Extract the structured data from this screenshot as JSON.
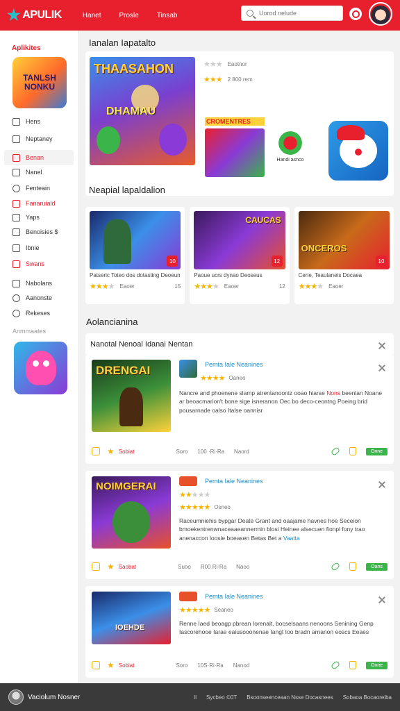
{
  "header": {
    "logo": "APULIK",
    "nav": [
      "Hanet",
      "Prosle",
      "Tinsab"
    ],
    "search_placeholder": "Uorod nelude"
  },
  "sidebar": {
    "title": "Aplikites",
    "art_text": "TANLSH NONKU",
    "items": [
      {
        "label": "Hens"
      },
      {
        "label": "Neptaney"
      },
      {
        "label": "Benan"
      },
      {
        "label": "Nanel"
      },
      {
        "label": "Fenteain"
      },
      {
        "label": "Fanaruiald"
      },
      {
        "label": "Yaps"
      },
      {
        "label": "Benoisies $"
      },
      {
        "label": "Ibnie"
      },
      {
        "label": "Swans"
      },
      {
        "label": "Nabolans"
      },
      {
        "label": "Aanonste"
      },
      {
        "label": "Rekeses"
      }
    ],
    "section_label": "Anmmaates"
  },
  "main": {
    "featured_title": "Ianalan Iapatalto",
    "hero": {
      "art_title": "THAASAHON",
      "art_sub": "DHAMAU",
      "meta1": "Eaotnor",
      "meta2": "2 800 rem",
      "mini1_text": "CROMENTRES",
      "mini2_text": "Handi asnco"
    },
    "popular_title": "Neapial lapaldalion",
    "cards": [
      {
        "caption": "Patseric Toteo dos dotasting Deoeun",
        "meta": "Eaoer",
        "num": "15",
        "badge": "10"
      },
      {
        "caption": "Paoue ucrs dynao Deoseus",
        "meta": "Eaoer",
        "num": "12",
        "badge": "12",
        "art_title": "CAUCAS"
      },
      {
        "caption": "Cerie, Teaulaneis Docaea",
        "meta": "Eaoer",
        "num": "",
        "badge": "10",
        "art_title": "ONCEROS"
      }
    ],
    "reviews_title": "Aolancianina",
    "reviews_head": "Nanotal Nenoal Idanai Nentan",
    "reviews": [
      {
        "art_title": "DRENGAI",
        "title": "Pemta Iale Neanines",
        "rating_text": "Oaneo",
        "body_pre": "Nancre and phoenene slamp atrentanooniz ooao hiarse ",
        "body_hl": "Nons",
        "body_post": " beenlan Noane ar beoacmarion't bone sige isneranon Oec bo deco-ceontng Poeing brid pousarnade oalso Italse oannisr",
        "foot_red": "Sobiat",
        "foot_mid": [
          "Soro",
          "100 ·Ri·Ra",
          "Naord"
        ],
        "btn": "Onne"
      },
      {
        "art_title": "NOIMGERAI",
        "title": "Pemta Iale Neanines",
        "rating_text": "Osneo",
        "body_pre": "Raceumniehis bypgar Deate Grant and oaajame havnes hoe Seceion bmoekentrenwnaceaaeannermin blosi Heinee alsecuen fionpl fony trao anenaccon loosie boeasen Betas Bet a ",
        "body_hl": "",
        "body_blue": "Vaatta",
        "body_post": "",
        "foot_red": "Saobat",
        "foot_mid": [
          "Suoo",
          "R00 Ri·Ra",
          "Naoo"
        ],
        "btn": "Oans"
      },
      {
        "art_title": "IOEHDE",
        "title": "Pemta Iale Neanines",
        "rating_text": "Seaneo",
        "body_pre": "Renne Iaed beoagp pbrean Iorenalt, bocselsaans nenoons Senining Genp Iascorehooe Iarae eaiusooonenae Iangt Ioo bradn arnanon eoscs Eeaes",
        "body_hl": "",
        "body_post": "",
        "foot_red": "Sobiat",
        "foot_mid": [
          "Soro",
          "10S·Ri·Ra",
          "Nanod"
        ],
        "btn": "Onrie"
      }
    ]
  },
  "footer": {
    "name": "Vaciolum Nosner",
    "links": [
      "Il",
      "Sycbeo ©0T",
      "Bsoonseenceaan Nsse Docasnees",
      "Sobaoa Bocaoreiba"
    ]
  },
  "colors": {
    "brand": "#e8202e",
    "accent_blue": "#1a8fc8",
    "accent_green": "#3bb54a",
    "star": "#f4b400"
  }
}
